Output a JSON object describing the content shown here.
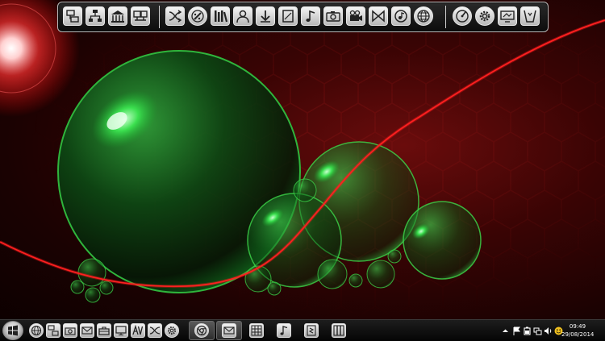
{
  "top_dock": {
    "group1": [
      {
        "name": "network-icon"
      },
      {
        "name": "org-chart-icon"
      },
      {
        "name": "building-icon"
      },
      {
        "name": "monitors-icon"
      }
    ],
    "group2": [
      {
        "name": "shuffle-icon"
      },
      {
        "name": "paint-icon"
      },
      {
        "name": "library-icon"
      },
      {
        "name": "user-icon"
      },
      {
        "name": "download-arrow-icon"
      },
      {
        "name": "document-icon"
      },
      {
        "name": "music-note-icon"
      },
      {
        "name": "camera-icon"
      },
      {
        "name": "video-camera-icon"
      },
      {
        "name": "media-player-icon"
      },
      {
        "name": "audio-disc-icon"
      },
      {
        "name": "globe-icon"
      }
    ],
    "group3": [
      {
        "name": "gauge-icon"
      },
      {
        "name": "settings-gear-icon"
      },
      {
        "name": "display-settings-icon"
      },
      {
        "name": "recycle-bin-icon"
      }
    ]
  },
  "taskbar": {
    "start": {
      "name": "windows-start-icon"
    },
    "quick_launch": [
      {
        "name": "globe-icon"
      },
      {
        "name": "network-icon"
      },
      {
        "name": "camera-icon"
      },
      {
        "name": "mail-icon"
      },
      {
        "name": "toolbox-icon"
      },
      {
        "name": "monitor-icon"
      },
      {
        "name": "av-icon"
      },
      {
        "name": "shuffle-icon"
      },
      {
        "name": "settings-gear-icon"
      }
    ],
    "tasks": [
      {
        "name": "chrome-icon",
        "active": true
      },
      {
        "name": "mail-envelope-icon",
        "active": true
      },
      {
        "name": "grid-icon",
        "active": false
      },
      {
        "name": "music-note-icon",
        "active": false
      },
      {
        "name": "notes-icon",
        "active": false
      },
      {
        "name": "panels-icon",
        "active": false
      }
    ],
    "tray": {
      "icons": [
        "show-hidden-icon",
        "flag-icon",
        "battery-icon",
        "network-icon",
        "volume-icon",
        "smiley-icon"
      ],
      "time": "09:49",
      "date": "29/08/2014"
    }
  }
}
